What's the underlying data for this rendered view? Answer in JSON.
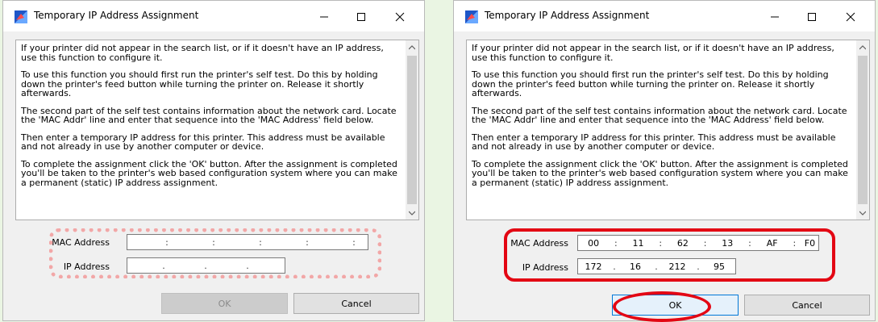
{
  "dialog": {
    "title": "Temporary IP Address Assignment",
    "info_paragraphs": [
      "If your printer did not appear in the search list, or if it doesn't have an IP address, use this function to configure it.",
      "To use this function you should first run the printer's self test.  Do this by holding down the printer's feed button while turning the printer on.  Release it shortly afterwards.",
      "The second part of the self test contains information about the network card. Locate the 'MAC Addr' line and enter that sequence into the 'MAC Address' field below.",
      "Then enter a temporary IP address for this printer.  This address must be available and not already in use by another computer or device.",
      "To complete the assignment click the 'OK' button.  After the assignment is completed you'll be taken to the printer's web based configuration system where you can make a permanent (static) IP address assignment."
    ],
    "mac_label": "MAC Address",
    "ip_label": "IP Address",
    "ok_label": "OK",
    "cancel_label": "Cancel",
    "mac_separator": ":",
    "ip_separator": "."
  },
  "left": {
    "mac_segments": [
      "",
      "",
      "",
      "",
      "",
      ""
    ],
    "ip_segments": [
      "",
      "",
      "",
      ""
    ],
    "ok_enabled": false,
    "highlight": "dotted pink"
  },
  "right": {
    "mac_segments": [
      "00",
      "11",
      "62",
      "13",
      "AF",
      "F0"
    ],
    "ip_segments": [
      "172",
      "16",
      "212",
      "95"
    ],
    "ok_enabled": true,
    "highlight": "solid red"
  },
  "colors": {
    "highlight_red": "#e30613",
    "highlight_pink": "#f2a7a7",
    "background": "#eaf5e3"
  },
  "icons": [
    "printer-network-app-icon",
    "minimize-icon",
    "maximize-icon",
    "close-icon",
    "scroll-up-arrow-icon",
    "scroll-down-arrow-icon"
  ]
}
